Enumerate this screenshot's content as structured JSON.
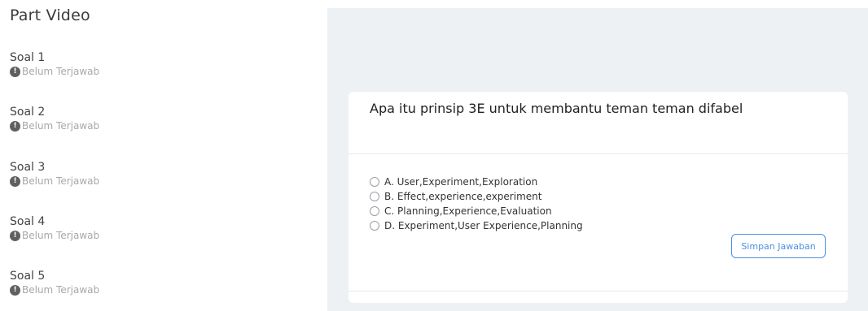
{
  "sidebar": {
    "title": "Part Video",
    "items": [
      {
        "label": "Soal 1",
        "status": "Belum Terjawab",
        "status_icon": "!"
      },
      {
        "label": "Soal 2",
        "status": "Belum Terjawab",
        "status_icon": "!"
      },
      {
        "label": "Soal 3",
        "status": "Belum Terjawab",
        "status_icon": "!"
      },
      {
        "label": "Soal 4",
        "status": "Belum Terjawab",
        "status_icon": "!"
      },
      {
        "label": "Soal 5",
        "status": "Belum Terjawab",
        "status_icon": "!"
      }
    ]
  },
  "question": {
    "text": "Apa itu prinsip 3E untuk membantu teman teman difabel",
    "options": [
      "A. User,Experiment,Exploration",
      "B. Effect,experience,experiment",
      "C. Planning,Experience,Evaluation",
      "D. Experiment,User Experience,Planning"
    ],
    "save_label": "Simpan Jawaban"
  },
  "colors": {
    "accent": "#4a90e2",
    "panel_background": "#eef1f4",
    "status_gray": "#a8a8a8"
  }
}
